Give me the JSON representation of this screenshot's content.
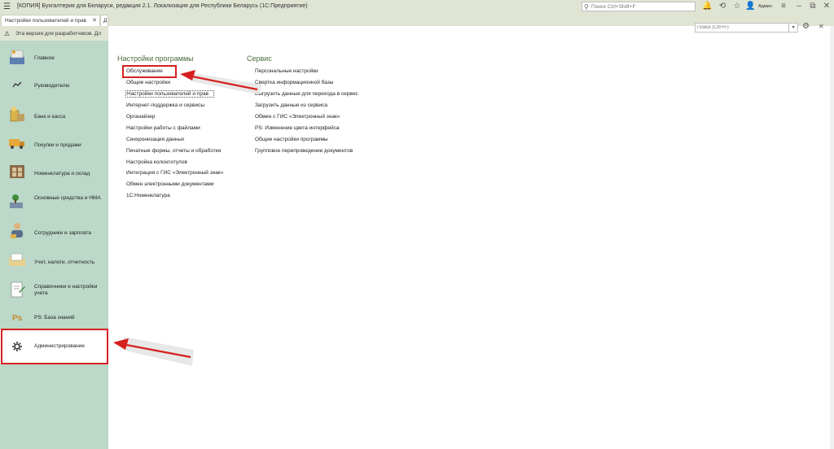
{
  "titlebar": {
    "title": "[КОПИЯ] Бухгалтерия для Беларуси, редакция 2.1. Локализация для Республики Беларусь  (1С:Предприятие)",
    "search_placeholder": "Поиск Ctrl+Shift+F",
    "user": "Админ"
  },
  "tabs": [
    {
      "label": "Настройки пользователей и прав"
    },
    {
      "label": "Д"
    }
  ],
  "warning": {
    "text": "Эта версия для разработчиков. Дл"
  },
  "sidebar": {
    "items": [
      {
        "label": "Главное"
      },
      {
        "label": "Руководителю"
      },
      {
        "label": "Банк и касса"
      },
      {
        "label": "Покупки и продажи"
      },
      {
        "label": "Номенклатура и склад"
      },
      {
        "label": "Основные средства и НМА"
      },
      {
        "label": "Сотрудники и зарплата"
      },
      {
        "label": "Учет, налоги, отчетность"
      },
      {
        "label": "Справочники и настройки учета"
      },
      {
        "label": "PS: База знаний"
      },
      {
        "label": "Администрирование"
      }
    ]
  },
  "main": {
    "search_placeholder": "Поиск (Ctrl+F)",
    "settings_column": {
      "title": "Настройки программы",
      "links": [
        "Обслуживание",
        "Общие настройки",
        "Настройки пользователей и прав",
        "Интернет-поддержка и сервисы",
        "Органайзер",
        "Настройки работы с файлами",
        "Синхронизация данных",
        "Печатные формы, отчеты и обработки",
        "Настройка колонтитулов",
        "Интеграция с ГИС «Электронный знак»",
        "Обмен электронными документами",
        "1С:Номенклатура"
      ]
    },
    "service_column": {
      "title": "Сервис",
      "links": [
        "Персональные настройки",
        "Свертка информационной базы",
        "Выгрузить данные для перехода в сервис",
        "Загрузить данные из сервиса",
        "Обмен с ГИС «Электронный знак»",
        "PS: Изменение цвета интерфейса",
        "Общие настройки программы",
        "Групповое перепроведение документов"
      ]
    }
  },
  "colors": {
    "sidebar_bg": "#bbd8c8",
    "titlebar_bg": "#dfe4d3",
    "column_title": "#4a6b3c",
    "highlight": "#d62020"
  }
}
